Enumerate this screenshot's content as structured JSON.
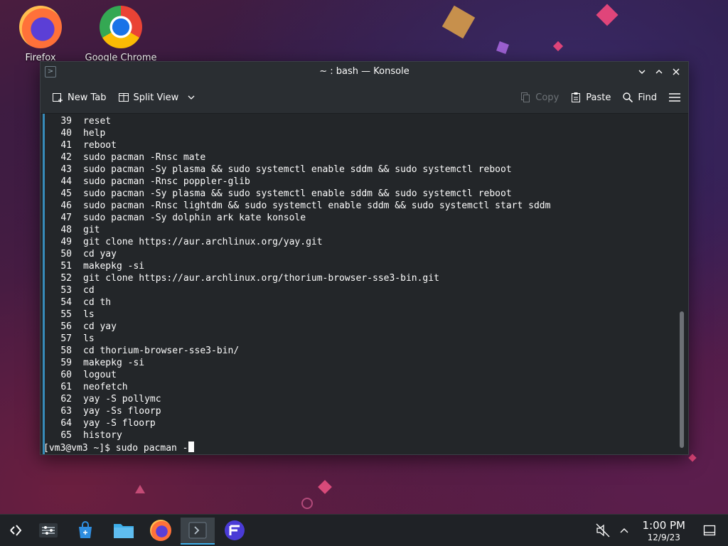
{
  "desktop": {
    "icons": [
      {
        "label": "Firefox",
        "icon": "firefox-icon"
      },
      {
        "label": "Google Chrome",
        "icon": "chrome-icon"
      }
    ]
  },
  "window": {
    "title": "~ : bash — Konsole",
    "toolbar": {
      "new_tab": "New Tab",
      "split_view": "Split View",
      "copy": "Copy",
      "paste": "Paste",
      "find": "Find"
    }
  },
  "terminal": {
    "history": [
      {
        "n": "39",
        "cmd": "reset"
      },
      {
        "n": "40",
        "cmd": "help"
      },
      {
        "n": "41",
        "cmd": "reboot"
      },
      {
        "n": "42",
        "cmd": "sudo pacman -Rnsc mate"
      },
      {
        "n": "43",
        "cmd": "sudo pacman -Sy plasma && sudo systemctl enable sddm && sudo systemctl reboot"
      },
      {
        "n": "44",
        "cmd": "sudo pacman -Rnsc poppler-glib"
      },
      {
        "n": "45",
        "cmd": "sudo pacman -Sy plasma && sudo systemctl enable sddm && sudo systemctl reboot"
      },
      {
        "n": "46",
        "cmd": "sudo pacman -Rnsc lightdm && sudo systemctl enable sddm && sudo systemctl start sddm"
      },
      {
        "n": "47",
        "cmd": "sudo pacman -Sy dolphin ark kate konsole"
      },
      {
        "n": "48",
        "cmd": "git"
      },
      {
        "n": "49",
        "cmd": "git clone https://aur.archlinux.org/yay.git"
      },
      {
        "n": "50",
        "cmd": "cd yay"
      },
      {
        "n": "51",
        "cmd": "makepkg -si"
      },
      {
        "n": "52",
        "cmd": "git clone https://aur.archlinux.org/thorium-browser-sse3-bin.git"
      },
      {
        "n": "53",
        "cmd": "cd"
      },
      {
        "n": "54",
        "cmd": "cd th"
      },
      {
        "n": "55",
        "cmd": "ls"
      },
      {
        "n": "56",
        "cmd": "cd yay"
      },
      {
        "n": "57",
        "cmd": "ls"
      },
      {
        "n": "58",
        "cmd": "cd thorium-browser-sse3-bin/"
      },
      {
        "n": "59",
        "cmd": "makepkg -si"
      },
      {
        "n": "60",
        "cmd": "logout"
      },
      {
        "n": "61",
        "cmd": "neofetch"
      },
      {
        "n": "62",
        "cmd": "yay -S pollymc"
      },
      {
        "n": "63",
        "cmd": "yay -Ss floorp"
      },
      {
        "n": "64",
        "cmd": "yay -S floorp"
      },
      {
        "n": "65",
        "cmd": "history"
      }
    ],
    "prompt": "[vm3@vm3 ~]$ ",
    "input": "sudo pacman -"
  },
  "taskbar": {
    "time": "1:00 PM",
    "date": "12/9/23"
  },
  "colors": {
    "accent": "#3daee9",
    "terminal_bg": "#232629",
    "titlebar_bg": "#2a2e32"
  }
}
